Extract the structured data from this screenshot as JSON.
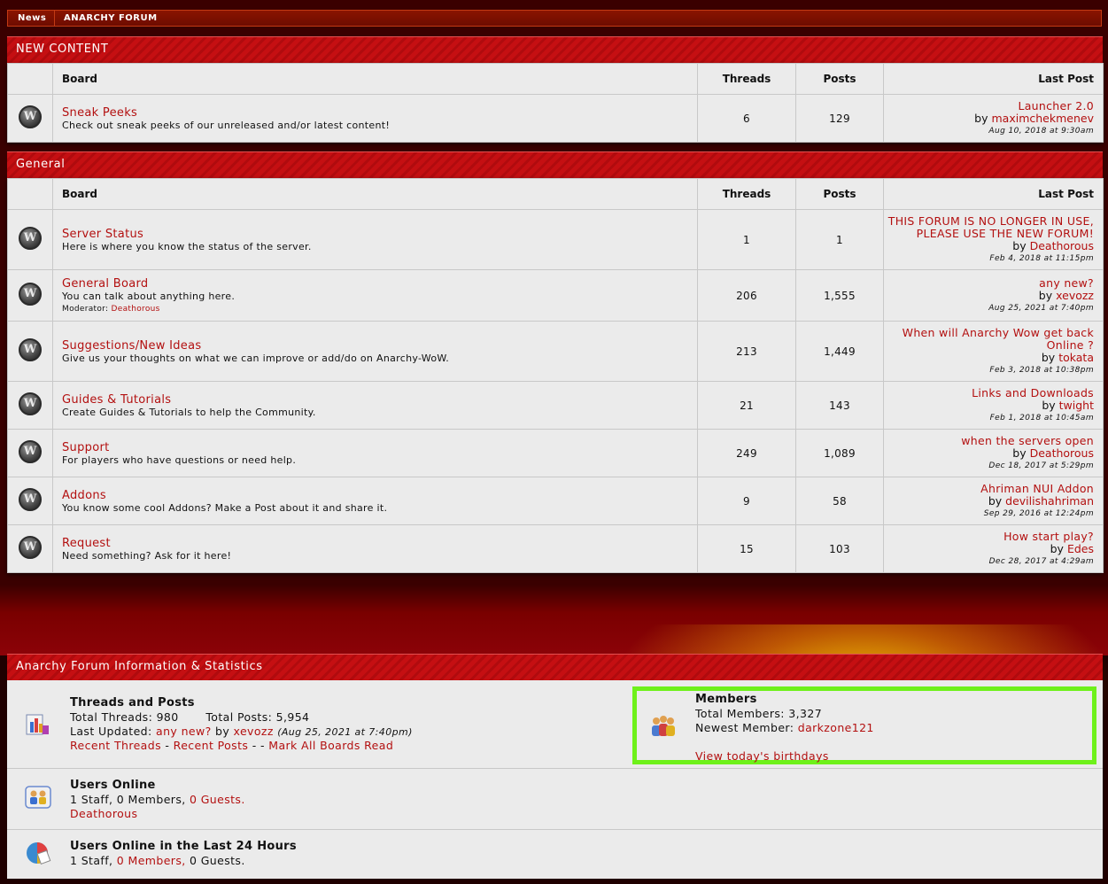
{
  "nav": {
    "items": [
      "News",
      "ANARCHY FORUM"
    ]
  },
  "columns": {
    "board": "Board",
    "threads": "Threads",
    "posts": "Posts",
    "last_post": "Last Post"
  },
  "sections": [
    {
      "title": "NEW CONTENT",
      "rows": [
        {
          "name": "Sneak Peeks",
          "desc": "Check out sneak peeks of our unreleased and/or latest content!",
          "threads": "6",
          "posts": "129",
          "last_title": "Launcher 2.0",
          "by": "by",
          "last_user": "maximchekmenev",
          "last_date": "Aug 10, 2018 at 9:30am"
        }
      ]
    },
    {
      "title": "General",
      "rows": [
        {
          "name": "Server Status",
          "desc": "Here is where you know the status of the server.",
          "threads": "1",
          "posts": "1",
          "last_title": "THIS FORUM IS NO LONGER IN USE, PLEASE USE THE NEW FORUM!",
          "by": "by",
          "last_user": "Deathorous",
          "last_date": "Feb 4, 2018 at 11:15pm"
        },
        {
          "name": "General Board",
          "desc": "You can talk about anything here.",
          "moderator_label": "Moderator:",
          "moderator": "Deathorous",
          "threads": "206",
          "posts": "1,555",
          "last_title": "any new?",
          "by": "by",
          "last_user": "xevozz",
          "last_date": "Aug 25, 2021 at 7:40pm"
        },
        {
          "name": "Suggestions/New Ideas",
          "desc": "Give us your thoughts on what we can improve or add/do on Anarchy-WoW.",
          "threads": "213",
          "posts": "1,449",
          "last_title": "When will Anarchy Wow get back Online ?",
          "by": "by",
          "last_user": "tokata",
          "last_date": "Feb 3, 2018 at 10:38pm"
        },
        {
          "name": "Guides & Tutorials",
          "desc": "Create Guides & Tutorials to help the Community.",
          "threads": "21",
          "posts": "143",
          "last_title": "Links and Downloads",
          "by": "by",
          "last_user": "twight",
          "last_date": "Feb 1, 2018 at 10:45am"
        },
        {
          "name": "Support",
          "desc": "For players who have questions or need help.",
          "threads": "249",
          "posts": "1,089",
          "last_title": "when the servers open",
          "by": "by",
          "last_user": "Deathorous",
          "last_date": "Dec 18, 2017 at 5:29pm"
        },
        {
          "name": "Addons",
          "desc": "You know some cool Addons? Make a Post about it and share it.",
          "threads": "9",
          "posts": "58",
          "last_title": "Ahriman NUI Addon",
          "by": "by",
          "last_user": "devilishahriman",
          "last_date": "Sep 29, 2016 at 12:24pm"
        },
        {
          "name": "Request",
          "desc": "Need something? Ask for it here!",
          "threads": "15",
          "posts": "103",
          "last_title": "How start play?",
          "by": "by",
          "last_user": "Edes",
          "last_date": "Dec 28, 2017 at 4:29am"
        }
      ]
    }
  ],
  "info": {
    "title": "Anarchy Forum Information & Statistics",
    "threads_posts": {
      "title": "Threads and Posts",
      "total_threads_label": "Total Threads:",
      "total_threads": "980",
      "total_posts_label": "Total Posts:",
      "total_posts": "5,954",
      "last_updated_label": "Last Updated:",
      "last_updated_link": "any new?",
      "by": "by",
      "last_updated_user": "xevozz",
      "last_updated_date": "(Aug 25, 2021 at 7:40pm)",
      "recent_threads": "Recent Threads",
      "dash1": "-",
      "recent_posts": "Recent Posts",
      "dash2": "- -",
      "mark_read": "Mark All Boards Read"
    },
    "members": {
      "title": "Members",
      "total_label": "Total Members:",
      "total": "3,327",
      "newest_label": "Newest Member:",
      "newest": "darkzone121",
      "birthdays": "View today's birthdays"
    },
    "users_online": {
      "title": "Users Online",
      "staff": "1 Staff,",
      "members": "0 Members,",
      "guests": "0 Guests.",
      "user": "Deathorous"
    },
    "online_24h": {
      "title": "Users Online in the Last 24 Hours",
      "staff": "1 Staff,",
      "members": "0 Members,",
      "guests": "0 Guests."
    }
  },
  "colors": {
    "accent_red": "#b31010",
    "header_red": "#c50f12",
    "highlight_green": "#6ef11a"
  }
}
